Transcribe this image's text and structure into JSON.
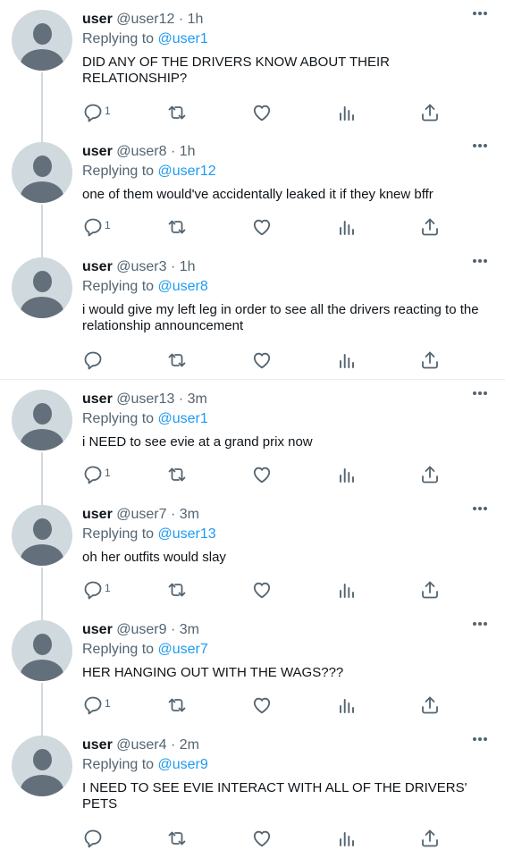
{
  "reply_prefix": "Replying to",
  "separator": "·",
  "colors": {
    "accent": "#1d9bf0",
    "secondary_text": "#536471",
    "avatar_bg": "#cfd9de",
    "avatar_fg": "#63707b"
  },
  "tweets": [
    {
      "name": "user",
      "handle": "@user12",
      "time": "1h",
      "reply_to": "@user1",
      "text": "DID ANY OF THE DRIVERS KNOW ABOUT THEIR RELATIONSHIP?",
      "reply_count": "1"
    },
    {
      "name": "user",
      "handle": "@user8",
      "time": "1h",
      "reply_to": "@user12",
      "text": "one of them would've accidentally leaked it if they knew bffr",
      "reply_count": "1"
    },
    {
      "name": "user",
      "handle": "@user3",
      "time": "1h",
      "reply_to": "@user8",
      "text": "i would give my left leg in order to see all the drivers reacting to the relationship announcement",
      "reply_count": ""
    },
    {
      "name": "user",
      "handle": "@user13",
      "time": "3m",
      "reply_to": "@user1",
      "text": "i NEED to see evie at a grand prix now",
      "reply_count": "1"
    },
    {
      "name": "user",
      "handle": "@user7",
      "time": "3m",
      "reply_to": "@user13",
      "text": "oh her outfits would slay",
      "reply_count": "1"
    },
    {
      "name": "user",
      "handle": "@user9",
      "time": "3m",
      "reply_to": "@user7",
      "text": "HER HANGING OUT WITH THE WAGS???",
      "reply_count": "1"
    },
    {
      "name": "user",
      "handle": "@user4",
      "time": "2m",
      "reply_to": "@user9",
      "text": "I NEED TO SEE EVIE INTERACT WITH ALL OF THE DRIVERS' PETS",
      "reply_count": ""
    }
  ]
}
